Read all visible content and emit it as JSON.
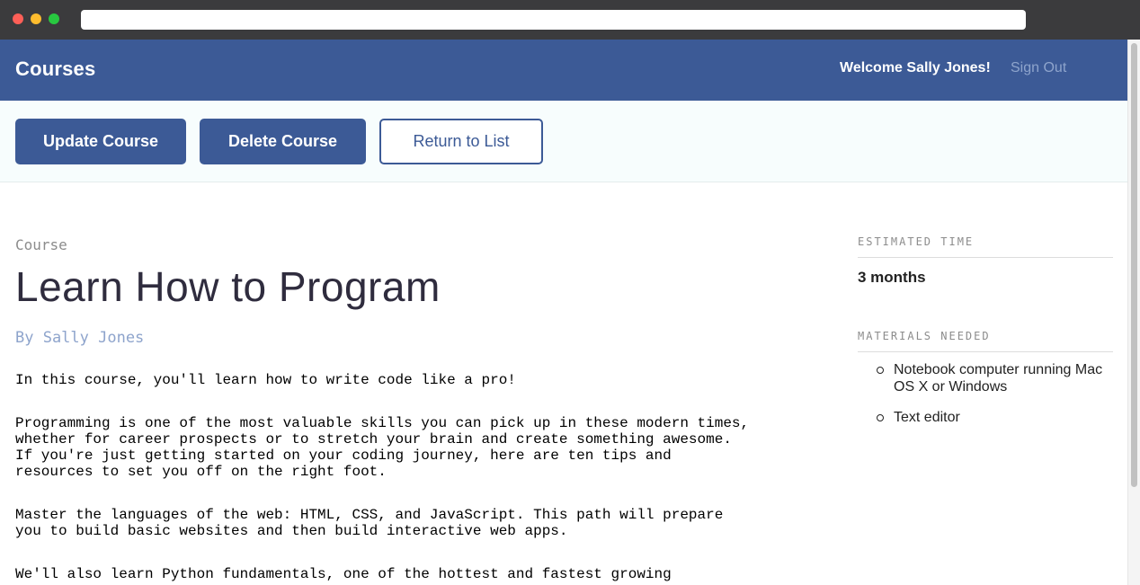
{
  "header": {
    "title": "Courses",
    "welcome": "Welcome Sally Jones!",
    "signout": "Sign Out"
  },
  "actions": {
    "update": "Update Course",
    "delete": "Delete Course",
    "return": "Return to List"
  },
  "course": {
    "label": "Course",
    "title": "Learn How to Program",
    "author": "By Sally Jones",
    "description": [
      "In this course, you'll learn how to write code like a pro!",
      "Programming is one of the most valuable skills you can pick up in these modern times, whether for career prospects or to stretch your brain and create something awesome. If you're just getting started on your coding journey, here are ten tips and resources to set you off on the right foot.",
      "Master the languages of the web: HTML, CSS, and JavaScript. This path will prepare you to build basic websites and then build interactive web apps.",
      "We'll also learn Python fundamentals, one of the hottest and fastest growing"
    ]
  },
  "sidebar": {
    "time_heading": "ESTIMATED TIME",
    "time_value": "3 months",
    "materials_heading": "MATERIALS NEEDED",
    "materials": [
      "Notebook computer running Mac OS X or Windows",
      "Text editor"
    ]
  },
  "colors": {
    "brand": "#3c5a96",
    "signout": "#8ea4cc",
    "action_bar_bg": "#f7fdfd"
  },
  "icons": {
    "traffic_lights": [
      "close-icon",
      "minimize-icon",
      "zoom-icon"
    ]
  }
}
